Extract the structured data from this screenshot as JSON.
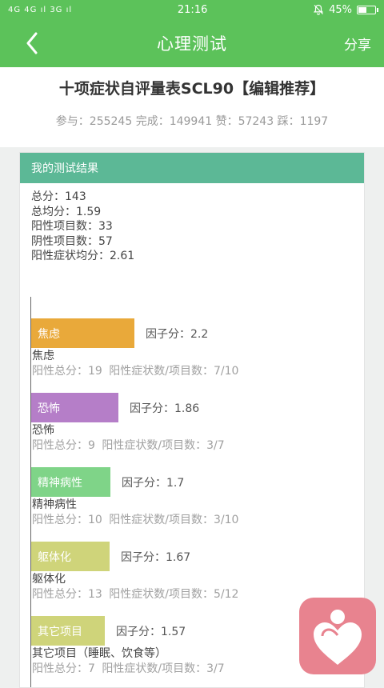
{
  "status": {
    "signal": "4G 4G ıl 3G ıl",
    "time": "21:16",
    "battery": "45%"
  },
  "appbar": {
    "title": "心理测试",
    "share": "分享"
  },
  "test": {
    "title": "十项症状自评量表SCL90【编辑推荐】",
    "stats": "参与：255245 完成：149941 赞：57243 踩：1197"
  },
  "result": {
    "header": "我的测试结果",
    "summary": [
      "总分：143",
      "总均分：1.59",
      "阳性项目数：33",
      "阴性项目数：57",
      "阳性症状均分：2.61"
    ]
  },
  "factors": [
    {
      "name": "焦虑",
      "score_text": "因子分：2.2",
      "score": 2.2,
      "detail": "阳性总分：19  阳性症状数/项目数：7/10",
      "color": "#e9a93a"
    },
    {
      "name": "恐怖",
      "score_text": "因子分：1.86",
      "score": 1.86,
      "detail": "阳性总分：9  阳性症状数/项目数：3/7",
      "color": "#b57ec8"
    },
    {
      "name": "精神病性",
      "score_text": "因子分：1.7",
      "score": 1.7,
      "detail": "阳性总分：10  阳性症状数/项目数：3/10",
      "color": "#7fd488"
    },
    {
      "name": "躯体化",
      "score_text": "因子分：1.67",
      "score": 1.67,
      "detail": "阳性总分：13  阳性症状数/项目数：5/12",
      "color": "#cfd47a"
    },
    {
      "name": "其它项目",
      "full_name": "其它项目（睡眠、饮食等）",
      "score_text": "因子分：1.57",
      "score": 1.57,
      "detail": "阳性总分：7  阳性症状数/项目数：3/7",
      "color": "#cfd47a"
    }
  ],
  "icons": {
    "back": "chevron-left-icon",
    "fab": "heart-person-icon"
  }
}
